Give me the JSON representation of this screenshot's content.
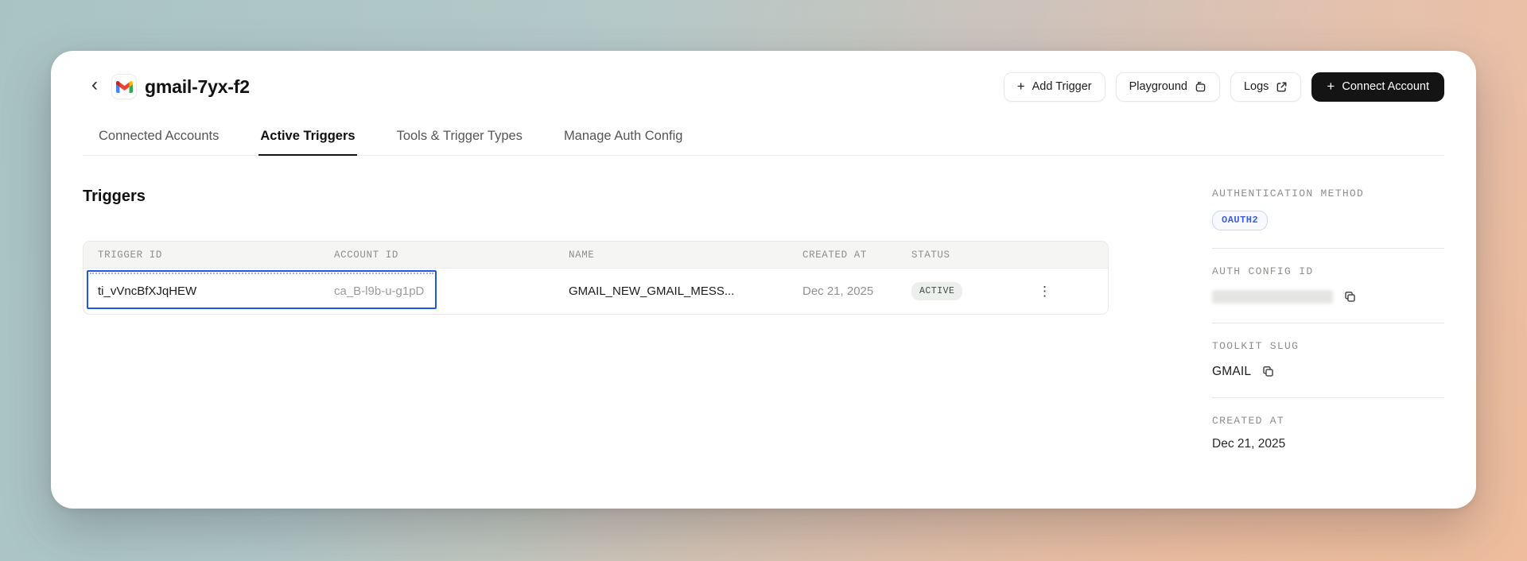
{
  "header": {
    "back_glyph": "‹",
    "app_icon": "gmail-logo",
    "title": "gmail-7yx-f2",
    "buttons": {
      "plus_glyph": "+",
      "add_trigger": "Add Trigger",
      "playground": "Playground",
      "logs": "Logs",
      "connect_account": "Connect Account"
    }
  },
  "tabs": [
    {
      "label": "Connected Accounts",
      "active": false
    },
    {
      "label": "Active Triggers",
      "active": true
    },
    {
      "label": "Tools & Trigger Types",
      "active": false
    },
    {
      "label": "Manage Auth Config",
      "active": false
    }
  ],
  "main": {
    "heading": "Triggers",
    "table": {
      "headers": [
        "TRIGGER ID",
        "ACCOUNT ID",
        "NAME",
        "CREATED AT",
        "STATUS"
      ],
      "rows": [
        {
          "trigger_id": "ti_vVncBfXJqHEW",
          "account_id": "ca_B-l9b-u-g1pD",
          "name": "GMAIL_NEW_GMAIL_MESS...",
          "created_at": "Dec 21, 2025",
          "status": "ACTIVE"
        }
      ],
      "row_menu_glyph": "⋮"
    }
  },
  "sidebar": {
    "auth_method_label": "AUTHENTICATION METHOD",
    "auth_method_value": "OAUTH2",
    "auth_config_label": "AUTH CONFIG ID",
    "auth_config_value_redacted": true,
    "toolkit_label": "TOOLKIT SLUG",
    "toolkit_value": "GMAIL",
    "created_label": "CREATED AT",
    "created_value": "Dec 21, 2025"
  },
  "colors": {
    "selection_blue": "#2356e0",
    "oauth_badge_text": "#3e5ede",
    "status_badge_bg": "#edefec",
    "dark_button_bg": "#141414",
    "bg_gradient_teal": "#a9c3c5",
    "bg_gradient_salmon": "#eebfa2"
  }
}
